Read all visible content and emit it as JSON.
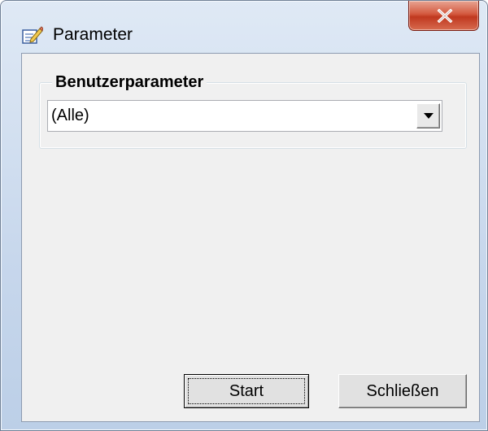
{
  "window": {
    "title": "Parameter"
  },
  "titlebar": {
    "close_icon": "close-icon",
    "app_icon": "edit-document-icon"
  },
  "group": {
    "legend": "Benutzerparameter",
    "combo": {
      "selected_value": "(Alle)",
      "arrow_icon": "chevron-down-icon"
    }
  },
  "buttons": {
    "start_label": "Start",
    "close_label": "Schließen"
  },
  "colors": {
    "client_bg": "#f0f0f0",
    "close_button_red": "#c0381f",
    "titlebar_blue": "#c7d7ec"
  }
}
